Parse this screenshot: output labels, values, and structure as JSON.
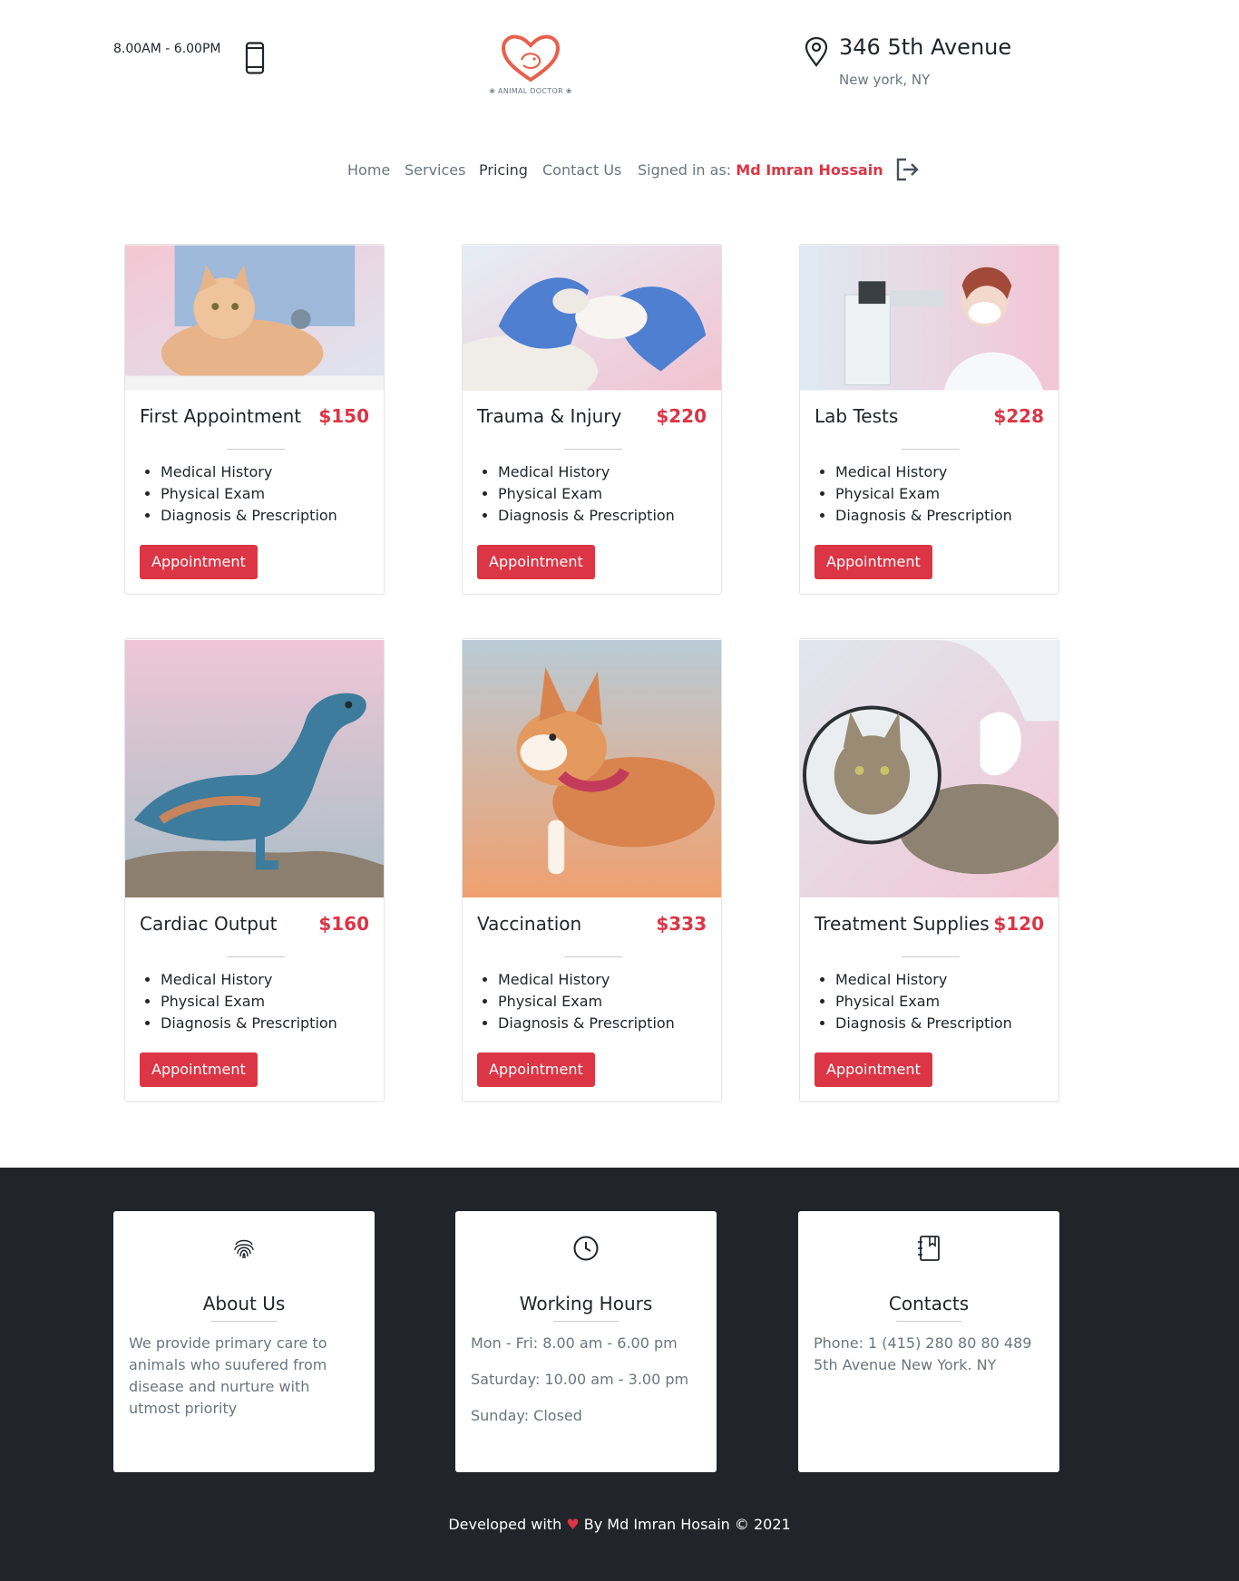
{
  "header": {
    "hours": "8.00AM - 6.00PM",
    "logo_text": "ANIMAL DOCTOR",
    "address_main": "346 5th Avenue",
    "address_sub": "New york, NY"
  },
  "nav": {
    "items": [
      {
        "label": "Home"
      },
      {
        "label": "Services"
      },
      {
        "label": "Pricing"
      },
      {
        "label": "Contact Us"
      }
    ],
    "signed_in_label": "Signed in as:",
    "user_name": "Md Imran Hossain"
  },
  "services": [
    {
      "title": "First Appointment",
      "price": "$150",
      "features": [
        "Medical History",
        "Physical Exam",
        "Diagnosis & Prescription"
      ],
      "button": "Appointment"
    },
    {
      "title": "Trauma & Injury",
      "price": "$220",
      "features": [
        "Medical History",
        "Physical Exam",
        "Diagnosis & Prescription"
      ],
      "button": "Appointment"
    },
    {
      "title": "Lab Tests",
      "price": "$228",
      "features": [
        "Medical History",
        "Physical Exam",
        "Diagnosis & Prescription"
      ],
      "button": "Appointment"
    },
    {
      "title": "Cardiac Output",
      "price": "$160",
      "features": [
        "Medical History",
        "Physical Exam",
        "Diagnosis & Prescription"
      ],
      "button": "Appointment"
    },
    {
      "title": "Vaccination",
      "price": "$333",
      "features": [
        "Medical History",
        "Physical Exam",
        "Diagnosis & Prescription"
      ],
      "button": "Appointment"
    },
    {
      "title": "Treatment Supplies",
      "price": "$120",
      "features": [
        "Medical History",
        "Physical Exam",
        "Diagnosis & Prescription"
      ],
      "button": "Appointment"
    }
  ],
  "footer": {
    "about": {
      "title": "About Us",
      "text": "We provide primary care to animals who suufered from disease and nurture with utmost priority"
    },
    "working_hours": {
      "title": "Working Hours",
      "lines": [
        "Mon - Fri: 8.00 am - 6.00 pm",
        "Saturday: 10.00 am - 3.00 pm",
        "Sunday: Closed"
      ]
    },
    "contacts": {
      "title": "Contacts",
      "lines": [
        "Phone: 1 (415) 280 80 80 489",
        "5th Avenue New York. NY"
      ]
    },
    "credit_prefix": "Developed with",
    "credit_suffix": "By Md Imran Hosain © 2021"
  },
  "colors": {
    "accent": "#dc3545",
    "footer_bg": "#212529"
  }
}
